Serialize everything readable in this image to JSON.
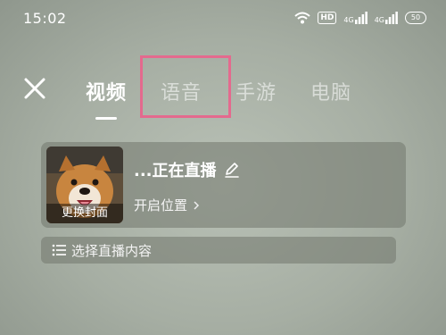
{
  "status_bar": {
    "time": "15:02",
    "hd_label": "HD",
    "network_1": "4G",
    "network_2": "4G",
    "battery": "50",
    "icons": [
      "wifi-icon",
      "hd-icon",
      "signal-icon",
      "signal-icon",
      "battery-icon"
    ]
  },
  "header": {
    "close_icon": "close-icon",
    "tabs": [
      {
        "label": "视频",
        "active": true
      },
      {
        "label": "语音",
        "active": false,
        "highlighted": true
      },
      {
        "label": "手游",
        "active": false
      },
      {
        "label": "电脑",
        "active": false
      }
    ]
  },
  "live_card": {
    "cover_label": "更换封面",
    "title": "...正在直播",
    "edit_icon": "pencil-icon",
    "location_label": "开启位置",
    "location_chevron": "chevron-right-icon"
  },
  "content_selector": {
    "icon": "list-icon",
    "label": "选择直播内容"
  },
  "colors": {
    "highlight_border": "#e46a8e",
    "card_background": "#767c72"
  }
}
